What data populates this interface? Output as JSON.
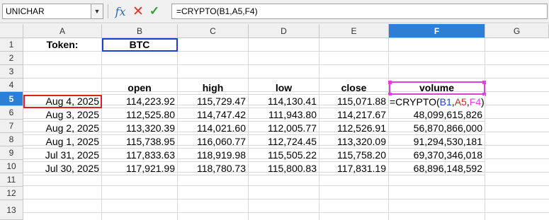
{
  "formula_bar": {
    "name_box": "UNICHAR",
    "function_icon": "fx-icon",
    "cancel_icon": "x-icon",
    "accept_icon": "check-icon",
    "formula": "=CRYPTO(B1,A5,F4)"
  },
  "columns": [
    "A",
    "B",
    "C",
    "D",
    "E",
    "F",
    "G"
  ],
  "rows": [
    "1",
    "2",
    "3",
    "4",
    "5",
    "6",
    "7",
    "8",
    "9",
    "10",
    "11",
    "12",
    "13"
  ],
  "sheet": {
    "token_label": "Token:",
    "token_value": "BTC",
    "headers": {
      "open": "open",
      "high": "high",
      "low": "low",
      "close": "close",
      "volume": "volume"
    },
    "data": [
      {
        "date": "Aug 4, 2025",
        "open": "114,223.92",
        "high": "115,729.47",
        "low": "114,130.41",
        "close": "115,071.88",
        "volume": ""
      },
      {
        "date": "Aug 3, 2025",
        "open": "112,525.80",
        "high": "114,747.42",
        "low": "111,943.80",
        "close": "114,217.67",
        "volume": "48,099,615,826"
      },
      {
        "date": "Aug 2, 2025",
        "open": "113,320.39",
        "high": "114,021.60",
        "low": "112,005.77",
        "close": "112,526.91",
        "volume": "56,870,866,000"
      },
      {
        "date": "Aug 1, 2025",
        "open": "115,738.95",
        "high": "116,060.77",
        "low": "112,724.45",
        "close": "113,320.09",
        "volume": "91,294,530,181"
      },
      {
        "date": "Jul 31, 2025",
        "open": "117,833.63",
        "high": "118,919.98",
        "low": "115,505.22",
        "close": "115,758.20",
        "volume": "69,370,346,018"
      },
      {
        "date": "Jul 30, 2025",
        "open": "117,921.99",
        "high": "118,780.73",
        "low": "115,800.83",
        "close": "117,831.19",
        "volume": "68,896,148,592"
      }
    ],
    "editing": {
      "prefix": "=CRYPTO(",
      "arg1": "B1",
      "comma1": ",",
      "arg2": "A5",
      "comma2": ",",
      "arg3": "F4",
      "suffix": ")"
    }
  },
  "colors": {
    "selection_header": "#2d7fd6",
    "ref_blue": "#1e3fd0",
    "ref_red": "#e02020",
    "ref_magenta": "#e040e0"
  }
}
